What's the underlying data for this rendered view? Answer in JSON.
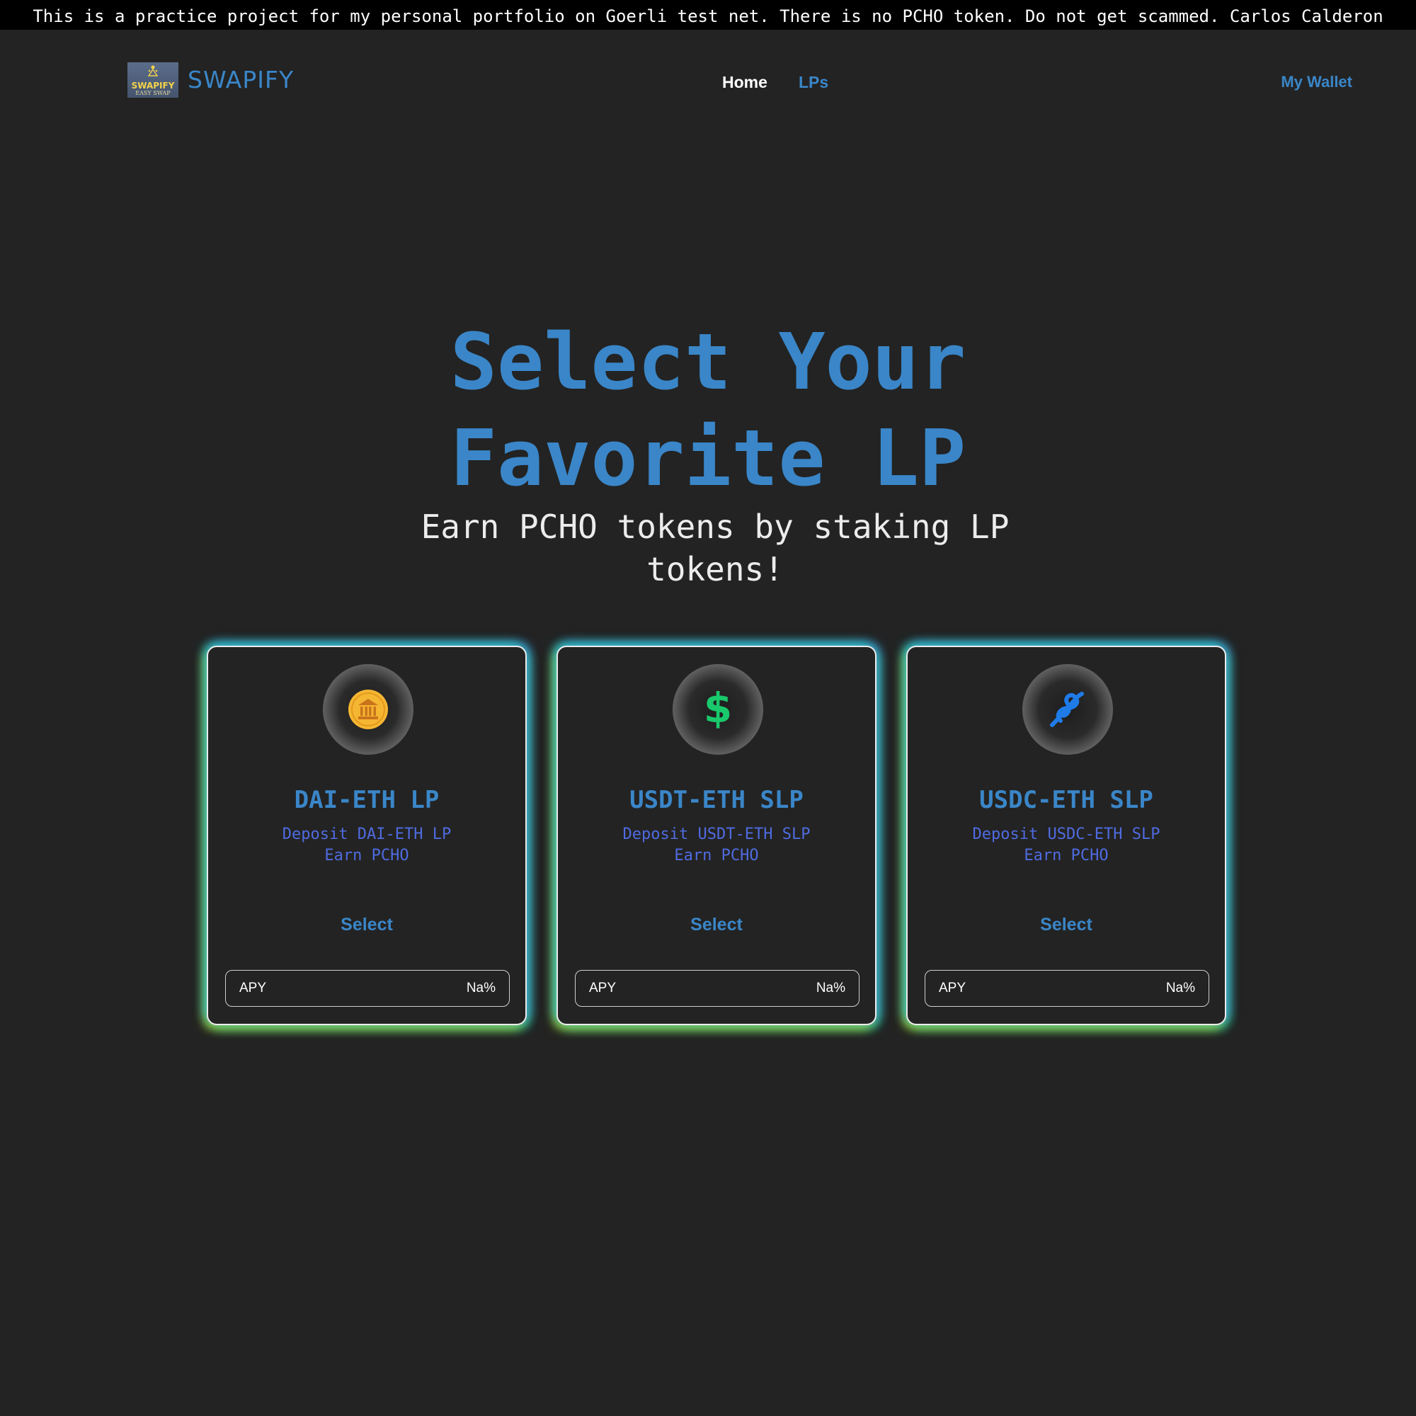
{
  "banner": {
    "text": "This is a practice project for my personal portfolio on Goerli test net. There is no PCHO token. Do not get scammed. Carlos Calderon"
  },
  "header": {
    "logo_title": "SWAPIFY",
    "logo_subtitle": "EASY SWAP",
    "brand": "SWAPIFY",
    "nav": {
      "home": "Home",
      "lps": "LPs"
    },
    "wallet": "My Wallet"
  },
  "hero": {
    "title_line1": "Select Your",
    "title_line2": "Favorite LP",
    "subtitle": "Earn PCHO tokens by staking LP tokens!"
  },
  "cards": [
    {
      "icon": "bank-icon",
      "name": "DAI-ETH LP",
      "desc_line1": "Deposit DAI-ETH LP",
      "desc_line2": "Earn PCHO",
      "select_label": "Select",
      "apy_label": "APY",
      "apy_value": "Na%"
    },
    {
      "icon": "dollar-icon",
      "name": "USDT-ETH SLP",
      "desc_line1": "Deposit USDT-ETH SLP",
      "desc_line2": "Earn PCHO",
      "select_label": "Select",
      "apy_label": "APY",
      "apy_value": "Na%"
    },
    {
      "icon": "knot-icon",
      "name": "USDC-ETH SLP",
      "desc_line1": "Deposit USDC-ETH SLP",
      "desc_line2": "Earn PCHO",
      "select_label": "Select",
      "apy_label": "APY",
      "apy_value": "Na%"
    }
  ],
  "colors": {
    "background": "#232323",
    "accent": "#3a86c8",
    "description": "#4f6be0",
    "bank_coin": "#f5b632",
    "dollar": "#19c96b",
    "knot": "#1f7be8"
  }
}
